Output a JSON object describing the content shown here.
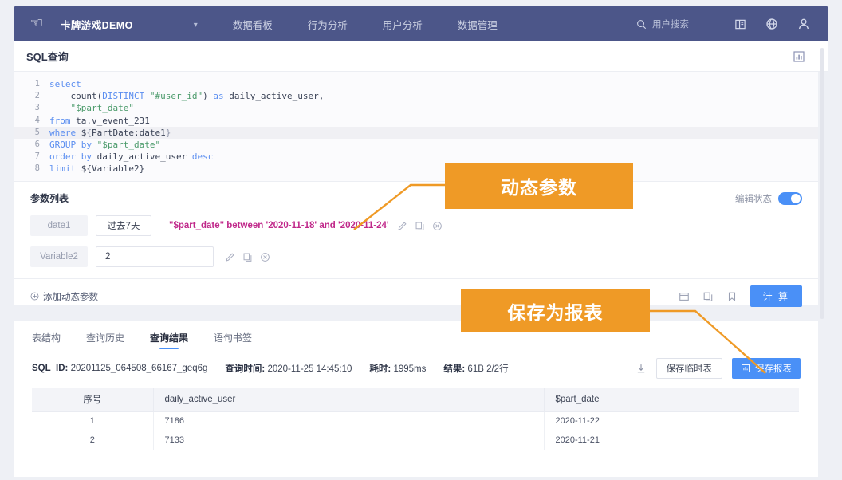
{
  "header": {
    "logo_icon": "hand-pointer-icon",
    "brand": "卡牌游戏DEMO",
    "brand_caret_icon": "chevron-down-icon",
    "nav": [
      {
        "label": "数据看板"
      },
      {
        "label": "行为分析"
      },
      {
        "label": "用户分析"
      },
      {
        "label": "数据管理"
      }
    ],
    "search_placeholder": "用户搜索",
    "search_icon": "search-icon",
    "book_icon": "book-icon",
    "globe_icon": "globe-icon",
    "user_icon": "user-icon",
    "bg_color": "#4c5689"
  },
  "titlebar": {
    "title": "SQL查询",
    "report_icon": "report-chart-icon"
  },
  "editor": {
    "lines": [
      {
        "no": "1",
        "segments": [
          {
            "t": "select",
            "c": "kw"
          }
        ]
      },
      {
        "no": "2",
        "segments": [
          {
            "t": "    count(",
            "c": "fn"
          },
          {
            "t": "DISTINCT",
            "c": "kw"
          },
          {
            "t": " ",
            "c": "fn"
          },
          {
            "t": "\"#user_id\"",
            "c": "str"
          },
          {
            "t": ") ",
            "c": "fn"
          },
          {
            "t": "as",
            "c": "kw"
          },
          {
            "t": " daily_active_user,",
            "c": "fn"
          }
        ]
      },
      {
        "no": "3",
        "segments": [
          {
            "t": "    ",
            "c": "fn"
          },
          {
            "t": "\"$part_date\"",
            "c": "str"
          }
        ]
      },
      {
        "no": "4",
        "segments": [
          {
            "t": "from",
            "c": "kw"
          },
          {
            "t": " ta.v_event_231",
            "c": "fn"
          }
        ]
      },
      {
        "no": "5",
        "highlight": true,
        "segments": [
          {
            "t": "where",
            "c": "kw"
          },
          {
            "t": " $",
            "c": "fn"
          },
          {
            "t": "{",
            "c": "curly"
          },
          {
            "t": "PartDate:date1",
            "c": "fn"
          },
          {
            "t": "}",
            "c": "curly"
          }
        ]
      },
      {
        "no": "6",
        "segments": [
          {
            "t": "GROUP",
            "c": "kw"
          },
          {
            "t": " ",
            "c": "fn"
          },
          {
            "t": "by",
            "c": "kw"
          },
          {
            "t": " ",
            "c": "fn"
          },
          {
            "t": "\"$part_date\"",
            "c": "str"
          }
        ]
      },
      {
        "no": "7",
        "segments": [
          {
            "t": "order",
            "c": "kw"
          },
          {
            "t": " ",
            "c": "fn"
          },
          {
            "t": "by",
            "c": "kw"
          },
          {
            "t": " daily_active_user ",
            "c": "fn"
          },
          {
            "t": "desc",
            "c": "kw"
          }
        ]
      },
      {
        "no": "8",
        "segments": [
          {
            "t": "limit",
            "c": "kw"
          },
          {
            "t": " ${Variable2}",
            "c": "fn"
          }
        ]
      }
    ]
  },
  "params": {
    "title": "参数列表",
    "edit_state_label": "编辑状态",
    "edit_state_on": true,
    "rows": [
      {
        "name": "date1",
        "value": "过去7天",
        "expression": "\"$part_date\" between '2020-11-18' and '2020-11-24'",
        "icons": [
          "edit-icon",
          "copy-icon",
          "delete-icon"
        ]
      },
      {
        "name": "Variable2",
        "value": "2",
        "expression": "",
        "icons": [
          "edit-icon",
          "copy-icon",
          "delete-icon"
        ]
      }
    ],
    "add_label": "添加动态参数",
    "add_icon": "plus-circle-icon",
    "footer_icons": [
      "save-draft-icon",
      "copy-icon",
      "bookmark-icon"
    ],
    "run_button": "计 算"
  },
  "results": {
    "tabs": [
      {
        "label": "表结构",
        "active": false
      },
      {
        "label": "查询历史",
        "active": false
      },
      {
        "label": "查询结果",
        "active": true
      },
      {
        "label": "语句书签",
        "active": false
      }
    ],
    "meta": {
      "sql_id_key": "SQL_ID:",
      "sql_id_value": "20201125_064508_66167_geq6g",
      "time_key": "查询时间:",
      "time_value": "2020-11-25 14:45:10",
      "cost_key": "耗时:",
      "cost_value": "1995ms",
      "result_key": "结果:",
      "result_value": "61B 2/2行"
    },
    "download_icon": "download-icon",
    "save_temp_button": "保存临时表",
    "save_report_button": "保存报表",
    "save_report_icon": "report-save-icon",
    "table": {
      "columns": [
        "序号",
        "daily_active_user",
        "$part_date"
      ],
      "rows": [
        [
          "1",
          "7186",
          "2020-11-22"
        ],
        [
          "2",
          "7133",
          "2020-11-21"
        ]
      ]
    }
  },
  "annotations": {
    "color": "#ef9a26",
    "items": [
      {
        "text": "动态参数"
      },
      {
        "text": "保存为报表"
      }
    ]
  }
}
